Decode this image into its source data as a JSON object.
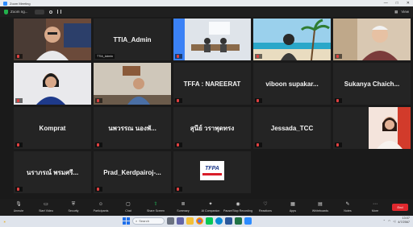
{
  "window": {
    "title": "Zoom Meeting",
    "controls": [
      "—",
      "□",
      "✕"
    ]
  },
  "meeting_header": {
    "info": "Zoom ng...",
    "view_label": "View"
  },
  "tiles": [
    {
      "name": "",
      "label": "",
      "kind": "video",
      "scene": "man-glasses",
      "active": true,
      "muted": true
    },
    {
      "name": "TTIA_Admin",
      "label": "TTIA_Admin",
      "kind": "name",
      "muted": false
    },
    {
      "name": "",
      "label": "",
      "kind": "video",
      "scene": "office",
      "muted": true
    },
    {
      "name": "",
      "label": "",
      "kind": "video",
      "scene": "beach",
      "muted": true
    },
    {
      "name": "",
      "label": "",
      "kind": "video",
      "scene": "man-white",
      "muted": true
    },
    {
      "name": "",
      "label": "",
      "kind": "video",
      "scene": "woman",
      "muted": true
    },
    {
      "name": "",
      "label": "",
      "kind": "video",
      "scene": "man-desk",
      "muted": true
    },
    {
      "name": "TFFA : NAREERAT",
      "label": "",
      "kind": "name",
      "muted": true
    },
    {
      "name": "viboon supakar...",
      "label": "",
      "kind": "name",
      "muted": true
    },
    {
      "name": "Sukanya Chaich...",
      "label": "",
      "kind": "name",
      "muted": true
    },
    {
      "name": "Komprat",
      "label": "",
      "kind": "name",
      "muted": true
    },
    {
      "name": "นพวรรณ นองพั...",
      "label": "",
      "kind": "name",
      "muted": true
    },
    {
      "name": "สุนีย์ วราพุดทรง",
      "label": "",
      "kind": "name",
      "muted": true
    },
    {
      "name": "Jessada_TCC",
      "label": "",
      "kind": "name",
      "muted": true
    },
    {
      "name": "",
      "label": "",
      "kind": "video",
      "scene": "woman-red",
      "muted": true
    },
    {
      "name": "นราภรณ์ พรมศรี...",
      "label": "",
      "kind": "name",
      "muted": true
    },
    {
      "name": "Prad_Kerdpairoj-...",
      "label": "",
      "kind": "name",
      "muted": true
    },
    {
      "name": "",
      "label": "",
      "kind": "logo",
      "logo_text": "TFPA",
      "muted": true
    }
  ],
  "toolbar": {
    "items": [
      {
        "label": "Unmute",
        "icon": "mic-icon"
      },
      {
        "label": "Start Video",
        "icon": "video-icon"
      },
      {
        "label": "Security",
        "icon": "shield-icon"
      },
      {
        "label": "Participants",
        "icon": "people-icon"
      },
      {
        "label": "Chat",
        "icon": "chat-icon"
      },
      {
        "label": "Share Screen",
        "icon": "share-icon",
        "green": true
      },
      {
        "label": "Summary",
        "icon": "summary-icon"
      },
      {
        "label": "AI Companion",
        "icon": "ai-icon"
      },
      {
        "label": "Pause/Stop Recording",
        "icon": "record-icon"
      },
      {
        "label": "Reactions",
        "icon": "heart-icon"
      },
      {
        "label": "Apps",
        "icon": "apps-icon"
      },
      {
        "label": "Whiteboards",
        "icon": "whiteboard-icon"
      },
      {
        "label": "Notes",
        "icon": "notes-icon"
      },
      {
        "label": "More",
        "icon": "more-icon"
      }
    ],
    "leave": "End"
  },
  "taskbar": {
    "search_placeholder": "Search",
    "time": "13:07",
    "date": "4/7/2567"
  }
}
